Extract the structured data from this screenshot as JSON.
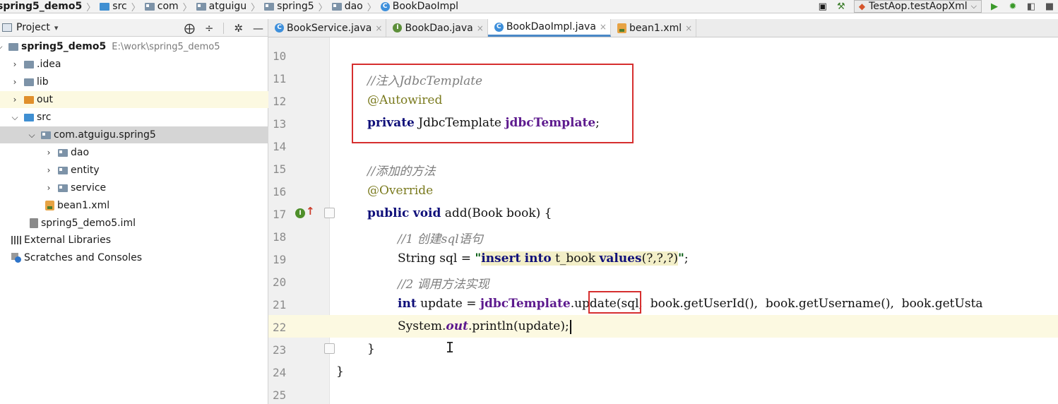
{
  "breadcrumb": {
    "items": [
      {
        "label": "spring5_demo5",
        "icon": "module-folder-icon"
      },
      {
        "label": "src",
        "icon": "source-folder-icon"
      },
      {
        "label": "com",
        "icon": "package-icon"
      },
      {
        "label": "atguigu",
        "icon": "package-icon"
      },
      {
        "label": "spring5",
        "icon": "package-icon"
      },
      {
        "label": "dao",
        "icon": "package-icon"
      },
      {
        "label": "BookDaoImpl",
        "icon": "class-icon"
      }
    ]
  },
  "toolbar": {
    "run_config": "TestAop.testAopXml",
    "icons": [
      "build-hammer-icon",
      "run-icon",
      "debug-icon",
      "coverage-icon",
      "stop-icon"
    ]
  },
  "project_panel": {
    "title": "Project",
    "tree": [
      {
        "label": "spring5_demo5",
        "path": "E:\\work\\spring5_demo5",
        "expanded": true,
        "icon": "module-folder-icon"
      },
      {
        "label": ".idea",
        "expanded": false,
        "icon": "folder-icon"
      },
      {
        "label": "lib",
        "expanded": false,
        "icon": "folder-icon"
      },
      {
        "label": "out",
        "expanded": false,
        "icon": "excluded-folder-icon"
      },
      {
        "label": "src",
        "expanded": true,
        "icon": "source-folder-icon"
      },
      {
        "label": "com.atguigu.spring5",
        "expanded": true,
        "icon": "package-icon"
      },
      {
        "label": "dao",
        "expanded": false,
        "icon": "package-icon"
      },
      {
        "label": "entity",
        "expanded": false,
        "icon": "package-icon"
      },
      {
        "label": "service",
        "expanded": false,
        "icon": "package-icon"
      },
      {
        "label": "bean1.xml",
        "icon": "xml-file-icon"
      },
      {
        "label": "spring5_demo5.iml",
        "icon": "iml-file-icon"
      },
      {
        "label": "External Libraries",
        "icon": "libraries-icon"
      },
      {
        "label": "Scratches and Consoles",
        "icon": "scratches-icon"
      }
    ]
  },
  "tabs": [
    {
      "label": "BookService.java",
      "icon": "class-icon",
      "active": false
    },
    {
      "label": "BookDao.java",
      "icon": "interface-icon",
      "active": false
    },
    {
      "label": "BookDaoImpl.java",
      "icon": "class-icon",
      "active": true
    },
    {
      "label": "bean1.xml",
      "icon": "xml-file-icon",
      "active": false
    }
  ],
  "editor": {
    "current_line": 22,
    "lines": [
      {
        "n": "10"
      },
      {
        "n": "11",
        "comment": "//注入JdbcTemplate"
      },
      {
        "n": "12",
        "annotation": "@Autowired"
      },
      {
        "n": "13",
        "kw": "private",
        "type": " JdbcTemplate ",
        "field": "jdbcTemplate",
        "tail": ";"
      },
      {
        "n": "14"
      },
      {
        "n": "15",
        "comment": "//添加的方法"
      },
      {
        "n": "16",
        "annotation": "@Override"
      },
      {
        "n": "17",
        "kw1": "public",
        "kw2": "void",
        "rest": " add(Book book) {"
      },
      {
        "n": "18",
        "comment": "//1 创建sql语句"
      },
      {
        "n": "19",
        "pre": "String sql = ",
        "q1": "\"",
        "s_kw1": "insert",
        "s_kw2": "into",
        "s_mid": " t_book ",
        "s_kw3": "values",
        "s_tail": "(?,?,?)",
        "q2": "\"",
        "end": ";"
      },
      {
        "n": "20",
        "comment": "//2 调用方法实现"
      },
      {
        "n": "21",
        "kw": "int",
        "pre": " update = ",
        "field": "jdbcTemplate",
        "dot": ".",
        "method": "update",
        "args": "(sql,  book.getUserId(),  book.getUsername(),  book.getUsta"
      },
      {
        "n": "22",
        "pre": "System.",
        "field": "out",
        "rest": ".println(update);"
      },
      {
        "n": "23",
        "rest": "}"
      },
      {
        "n": "24",
        "rest": "}"
      },
      {
        "n": "25"
      }
    ]
  },
  "colors": {
    "highlight_box": "#d62f2f",
    "current_line": "#fcf9e1",
    "tab_accent": "#4a88c7"
  }
}
